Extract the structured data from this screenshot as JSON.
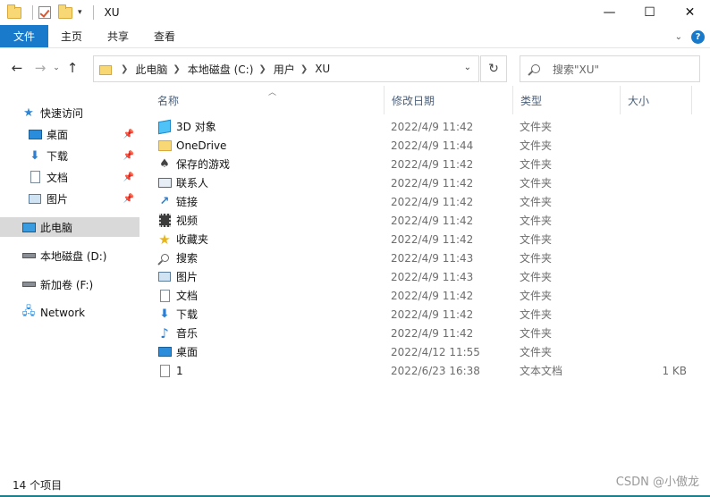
{
  "title_bar": {
    "title": "XU",
    "buttons": {
      "minimize": "—",
      "maximize": "☐",
      "close": "✕"
    }
  },
  "ribbon": {
    "tabs": [
      {
        "label": "文件"
      },
      {
        "label": "主页"
      },
      {
        "label": "共享"
      },
      {
        "label": "查看"
      }
    ],
    "help": "?"
  },
  "address": {
    "crumbs": [
      "此电脑",
      "本地磁盘 (C:)",
      "用户",
      "XU"
    ],
    "search_placeholder": "搜索\"XU\""
  },
  "nav_pane": {
    "items": [
      {
        "label": "快速访问",
        "icon": "star-icon",
        "pinned": false
      },
      {
        "label": "桌面",
        "icon": "desktop-icon",
        "pinned": true
      },
      {
        "label": "下载",
        "icon": "download-icon",
        "pinned": true
      },
      {
        "label": "文档",
        "icon": "document-icon",
        "pinned": true
      },
      {
        "label": "图片",
        "icon": "picture-icon",
        "pinned": true
      },
      {
        "label": "此电脑",
        "icon": "computer-icon",
        "pinned": false,
        "selected": true
      },
      {
        "label": "本地磁盘 (D:)",
        "icon": "drive-icon",
        "pinned": false
      },
      {
        "label": "新加卷 (F:)",
        "icon": "drive-icon",
        "pinned": false
      },
      {
        "label": "Network",
        "icon": "network-icon",
        "pinned": false
      }
    ]
  },
  "columns": {
    "name": "名称",
    "date": "修改日期",
    "type": "类型",
    "size": "大小"
  },
  "files": [
    {
      "name": "3D 对象",
      "date": "2022/4/9 11:42",
      "type": "文件夹",
      "size": "",
      "icon": "cube-3d-icon"
    },
    {
      "name": "OneDrive",
      "date": "2022/4/9 11:44",
      "type": "文件夹",
      "size": "",
      "icon": "folder-icon"
    },
    {
      "name": "保存的游戏",
      "date": "2022/4/9 11:42",
      "type": "文件夹",
      "size": "",
      "icon": "game-icon"
    },
    {
      "name": "联系人",
      "date": "2022/4/9 11:42",
      "type": "文件夹",
      "size": "",
      "icon": "contacts-icon"
    },
    {
      "name": "链接",
      "date": "2022/4/9 11:42",
      "type": "文件夹",
      "size": "",
      "icon": "link-icon"
    },
    {
      "name": "视频",
      "date": "2022/4/9 11:42",
      "type": "文件夹",
      "size": "",
      "icon": "video-icon"
    },
    {
      "name": "收藏夹",
      "date": "2022/4/9 11:42",
      "type": "文件夹",
      "size": "",
      "icon": "star-icon"
    },
    {
      "name": "搜索",
      "date": "2022/4/9 11:43",
      "type": "文件夹",
      "size": "",
      "icon": "search-icon"
    },
    {
      "name": "图片",
      "date": "2022/4/9 11:43",
      "type": "文件夹",
      "size": "",
      "icon": "picture-icon"
    },
    {
      "name": "文档",
      "date": "2022/4/9 11:42",
      "type": "文件夹",
      "size": "",
      "icon": "document-icon"
    },
    {
      "name": "下载",
      "date": "2022/4/9 11:42",
      "type": "文件夹",
      "size": "",
      "icon": "download-icon"
    },
    {
      "name": "音乐",
      "date": "2022/4/9 11:42",
      "type": "文件夹",
      "size": "",
      "icon": "music-icon"
    },
    {
      "name": "桌面",
      "date": "2022/4/12 11:55",
      "type": "文件夹",
      "size": "",
      "icon": "desktop-icon"
    },
    {
      "name": "1",
      "date": "2022/6/23 16:38",
      "type": "文本文档",
      "size": "1 KB",
      "icon": "text-file-icon"
    }
  ],
  "status": {
    "count": "14 个项目"
  },
  "watermark": "CSDN @小傲龙",
  "colors": {
    "accent": "#1979ca",
    "selected_bg": "#d9d9d9",
    "folder": "#f8d775"
  }
}
